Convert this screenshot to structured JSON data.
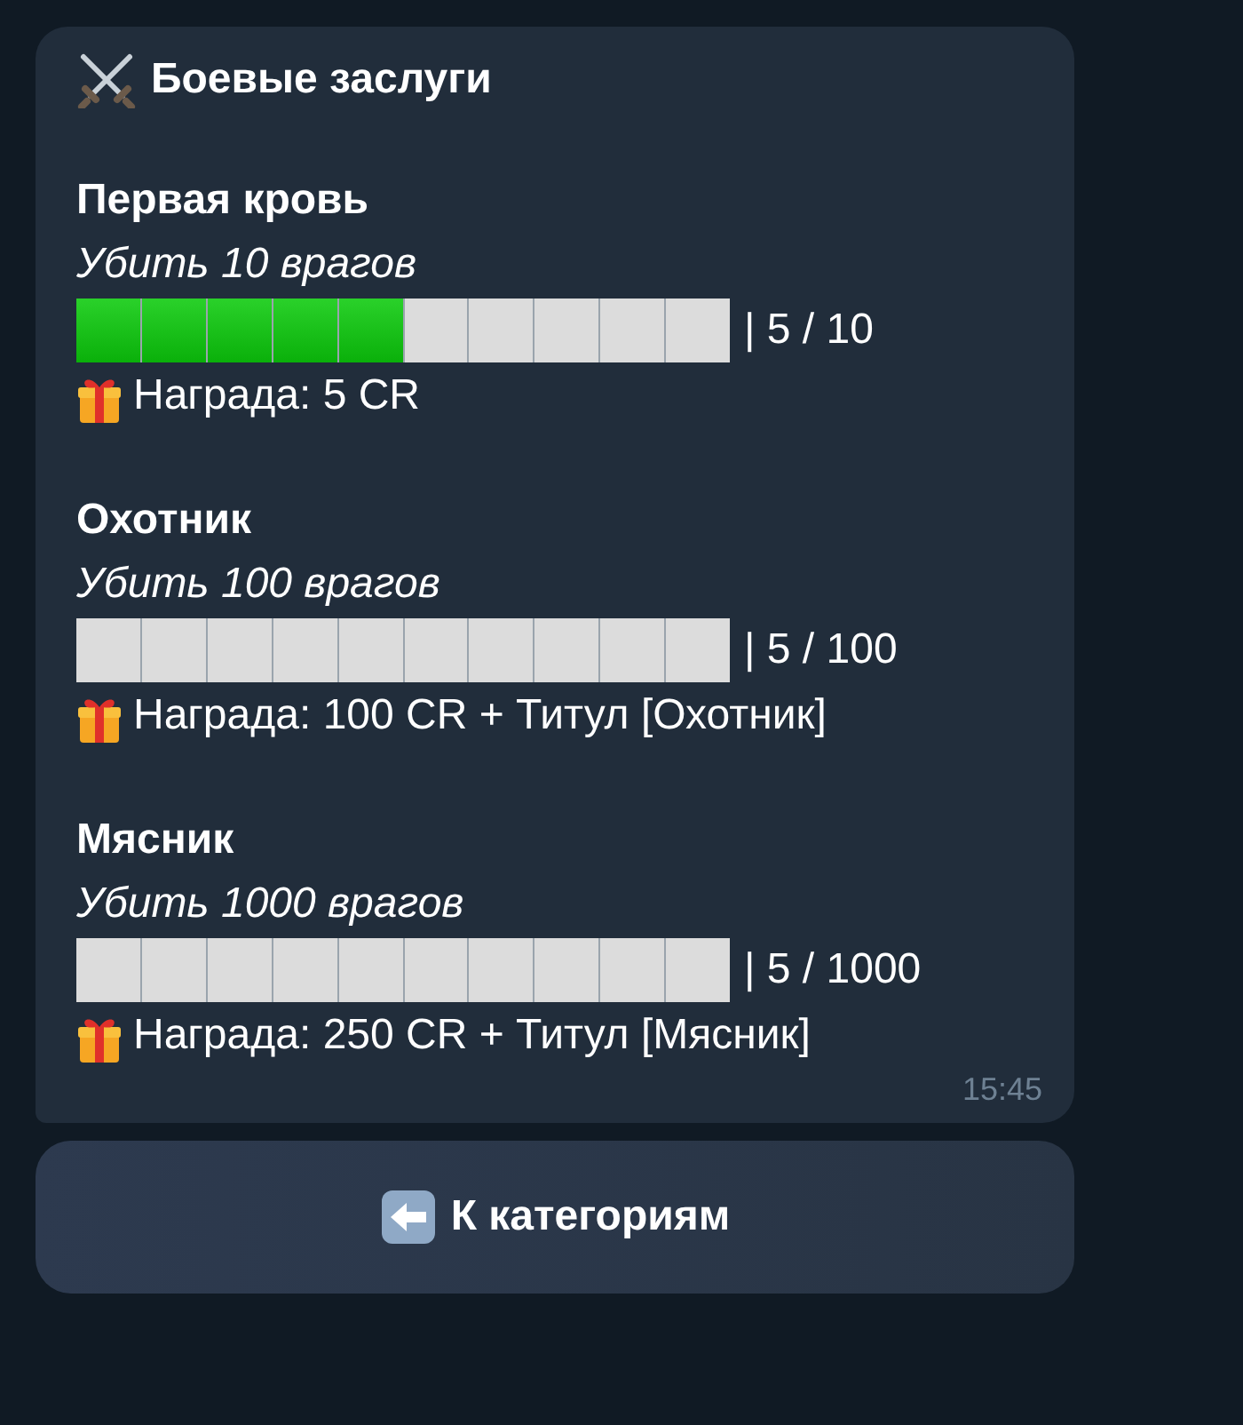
{
  "message": {
    "title": "Боевые заслуги",
    "achievements": [
      {
        "name": "Первая кровь",
        "task": "Убить 10 врагов",
        "level": 0.5,
        "progress": "| 5 / 10",
        "reward": "Награда: 5 CR"
      },
      {
        "name": "Охотник",
        "task": "Убить 100 врагов",
        "level": 0,
        "progress": "| 5 / 100",
        "reward": "Награда: 100 CR + Титул [Охотник]"
      },
      {
        "name": "Мясник",
        "task": "Убить 1000 врагов",
        "level": 0,
        "progress": "| 5 / 1000",
        "reward": "Награда: 250 CR + Титул [Мясник]"
      }
    ],
    "time": "15:45"
  },
  "buttons": [
    {
      "label": "К категориям"
    }
  ]
}
